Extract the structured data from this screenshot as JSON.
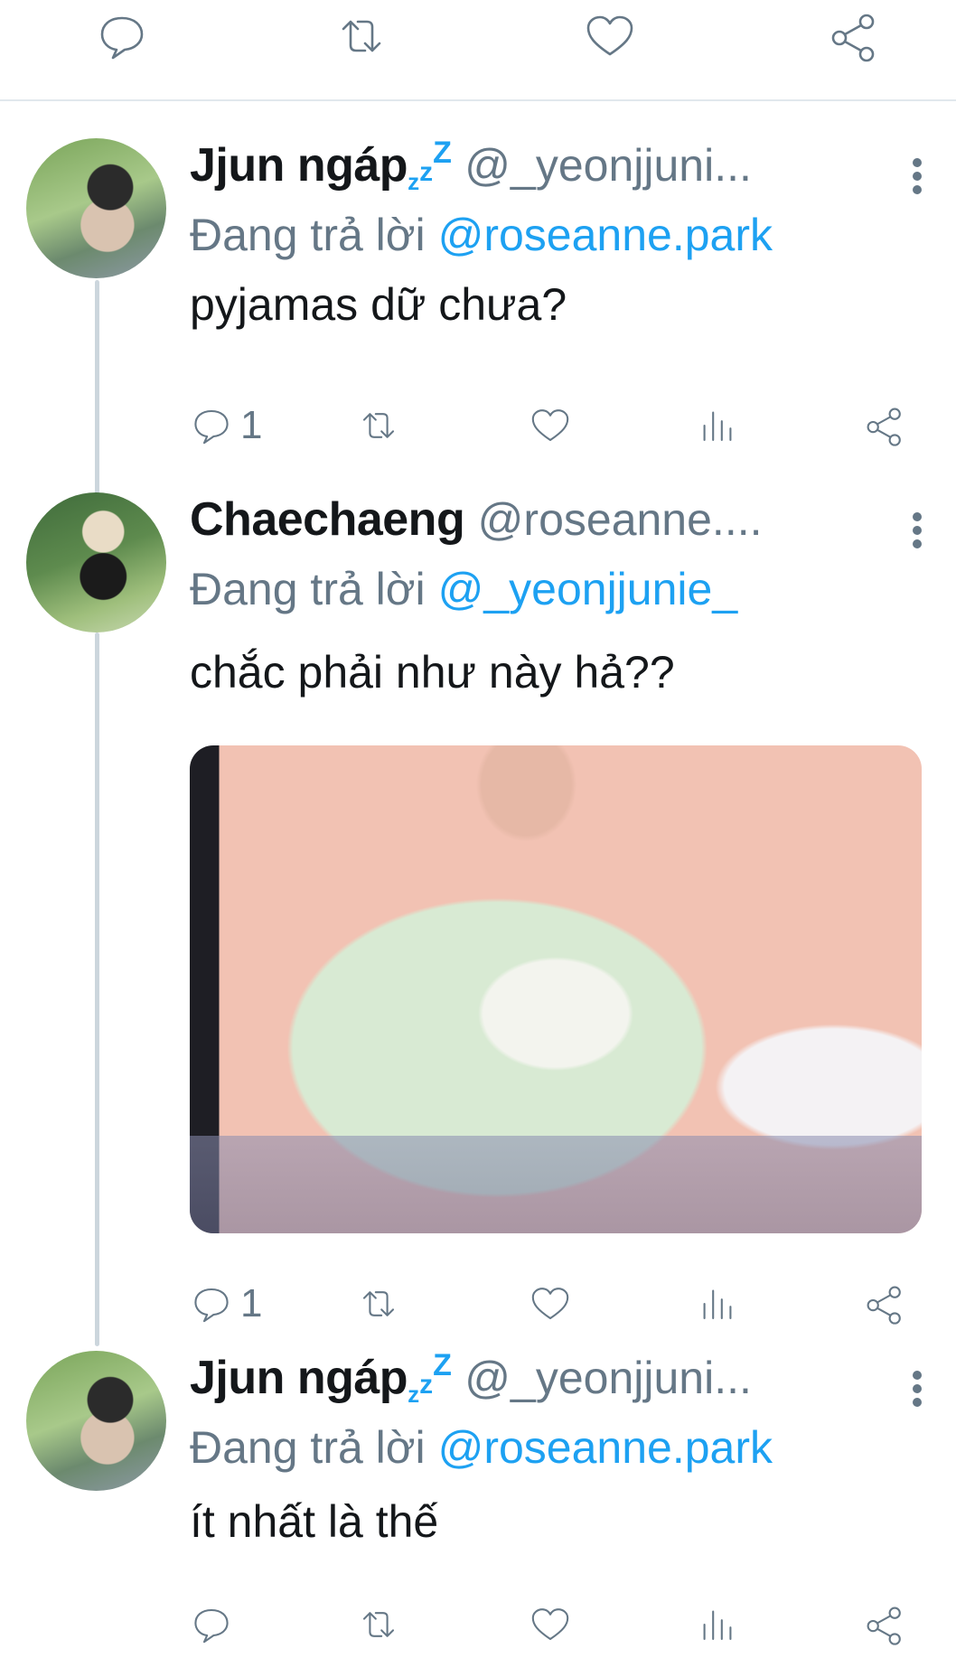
{
  "colors": {
    "accent": "#1da1f2",
    "muted": "#657786",
    "text": "#14171a",
    "thread_line": "#ccd6dd"
  },
  "top_actions": [
    "reply-icon",
    "retweet-icon",
    "like-icon",
    "share-icon"
  ],
  "tweets": [
    {
      "display_name": "Jjun ngáp",
      "emoji_small": "z",
      "emoji_mid": "z",
      "emoji_big": "Z",
      "handle": "@_yeonjjuni...",
      "reply_prefix": "Đang trả lời",
      "reply_mention": "@roseanne.park",
      "text": "pyjamas dữ chưa?",
      "reply_count": "1"
    },
    {
      "display_name": "Chaechaeng",
      "handle": "@roseanne....",
      "reply_prefix": "Đang trả lời",
      "reply_mention": "@_yeonjjunie_",
      "text": "chắc phải như này hả??",
      "reply_count": "1"
    },
    {
      "display_name": "Jjun ngáp",
      "emoji_small": "z",
      "emoji_mid": "z",
      "emoji_big": "Z",
      "handle": "@_yeonjjuni...",
      "reply_prefix": "Đang trả lời",
      "reply_mention": "@roseanne.park",
      "text": "ít nhất là thế",
      "reply_count": ""
    }
  ]
}
